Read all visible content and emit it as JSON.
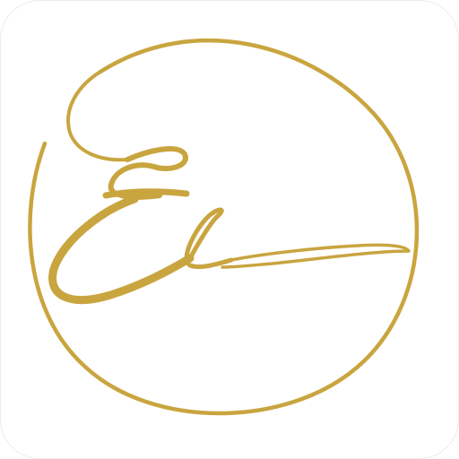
{
  "icon": {
    "name": "app-icon",
    "logo": "monogram-logo-icon",
    "monogram_letters": "Ee"
  },
  "colors": {
    "background": "#ffffff",
    "gold": "#c9a53f",
    "border": "#ececec"
  }
}
